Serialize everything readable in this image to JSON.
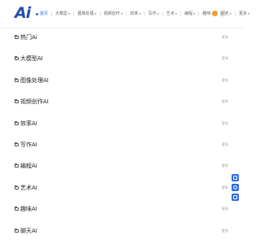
{
  "header": {
    "logo_text": "Ai",
    "nav": [
      {
        "label": "首页",
        "active": true,
        "caret": false
      },
      {
        "label": "大模型",
        "active": false,
        "caret": true
      },
      {
        "label": "图像处理",
        "active": false,
        "caret": true
      },
      {
        "label": "视频创作",
        "active": false,
        "caret": true
      },
      {
        "label": "效率",
        "active": false,
        "caret": true
      },
      {
        "label": "写作",
        "active": false,
        "caret": true
      },
      {
        "label": "艺术",
        "active": false,
        "caret": true
      },
      {
        "label": "编程",
        "active": false,
        "caret": true
      },
      {
        "label": "趣味",
        "active": false,
        "caret": true
      },
      {
        "label": "聊天",
        "active": false,
        "caret": true
      },
      {
        "label": "更多",
        "active": false,
        "caret": true
      }
    ]
  },
  "sections": [
    {
      "title": "热门Ai",
      "more": "更多"
    },
    {
      "title": "大模型AI",
      "more": "更多"
    },
    {
      "title": "图像处理AI",
      "more": "更多"
    },
    {
      "title": "视频创作AI",
      "more": "更多"
    },
    {
      "title": "效率AI",
      "more": "更多"
    },
    {
      "title": "写作AI",
      "more": "更多"
    },
    {
      "title": "编程AI",
      "more": "更多"
    },
    {
      "title": "艺术AI",
      "more": "更多"
    },
    {
      "title": "趣味AI",
      "more": "更多"
    },
    {
      "title": "聊天AI",
      "more": "更多"
    }
  ],
  "side_tools": [
    {
      "icon": "feedback-icon"
    },
    {
      "icon": "service-icon"
    },
    {
      "icon": "chat-icon"
    }
  ],
  "colors": {
    "brand": "#2350a8",
    "accent": "#2a6ae8",
    "avatar": "#f29d38"
  }
}
